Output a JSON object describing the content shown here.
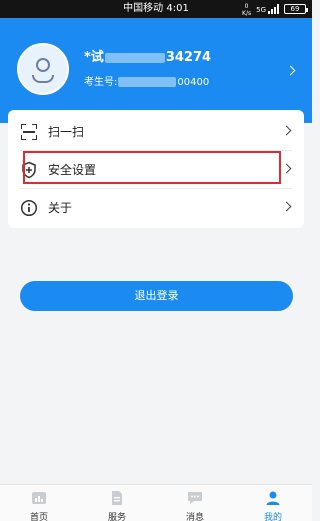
{
  "status_bar": {
    "carrier_time": "中国移动 4:01",
    "net_speed_value": "0",
    "net_speed_unit": "K/s",
    "network": "5G",
    "battery": "69"
  },
  "profile": {
    "name_prefix": "*试",
    "name_suffix": "34274",
    "exam_no_label": "考生号:",
    "exam_no_suffix": "00400"
  },
  "menu": {
    "items": [
      {
        "label": "扫一扫",
        "icon": "scan-icon"
      },
      {
        "label": "安全设置",
        "icon": "shield-plus-icon"
      },
      {
        "label": "关于",
        "icon": "info-icon"
      }
    ]
  },
  "logout_label": "退出登录",
  "tabbar": {
    "tabs": [
      {
        "label": "首页",
        "icon": "home-icon"
      },
      {
        "label": "服务",
        "icon": "document-icon"
      },
      {
        "label": "消息",
        "icon": "message-icon"
      },
      {
        "label": "我的",
        "icon": "person-icon",
        "active": true
      }
    ]
  },
  "colors": {
    "accent": "#1b8bf1",
    "highlight": "#e02c2c"
  }
}
